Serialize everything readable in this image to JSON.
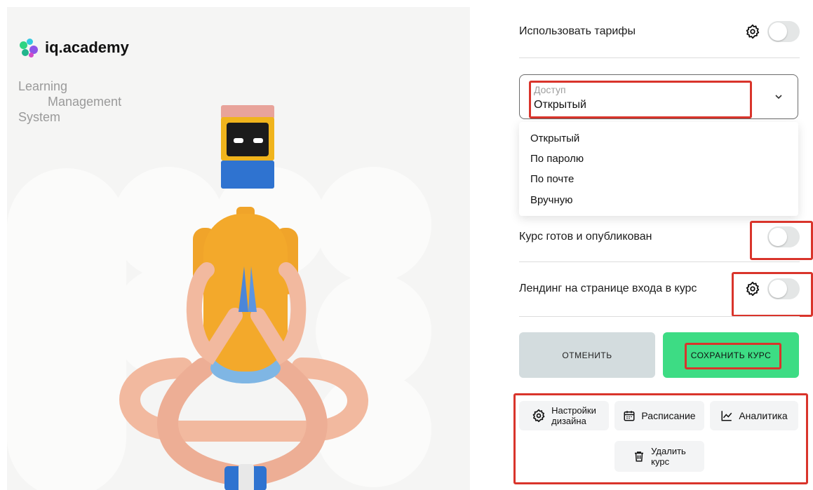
{
  "brand": {
    "name": "iq.academy",
    "tagline": [
      "Learning",
      "Management",
      "System"
    ]
  },
  "settings": {
    "use_tariffs": {
      "label": "Использовать тарифы"
    },
    "access": {
      "label": "Доступ",
      "value": "Открытый",
      "options": [
        "Открытый",
        "По паролю",
        "По почте",
        "Вручную"
      ]
    },
    "published": {
      "label": "Курс готов и опубликован"
    },
    "landing": {
      "label": "Лендинг на странице входа в курс"
    }
  },
  "buttons": {
    "cancel": "ОТМЕНИТЬ",
    "save": "СОХРАНИТЬ КУРС"
  },
  "actions": {
    "design": [
      "Настройки",
      "дизайна"
    ],
    "schedule": "Расписание",
    "analytics": "Аналитика",
    "delete": [
      "Удалить",
      "курс"
    ]
  },
  "colors": {
    "save_green": "#3ddc84",
    "cancel_gray": "#d3dcde",
    "highlight_red": "#d9342b"
  }
}
